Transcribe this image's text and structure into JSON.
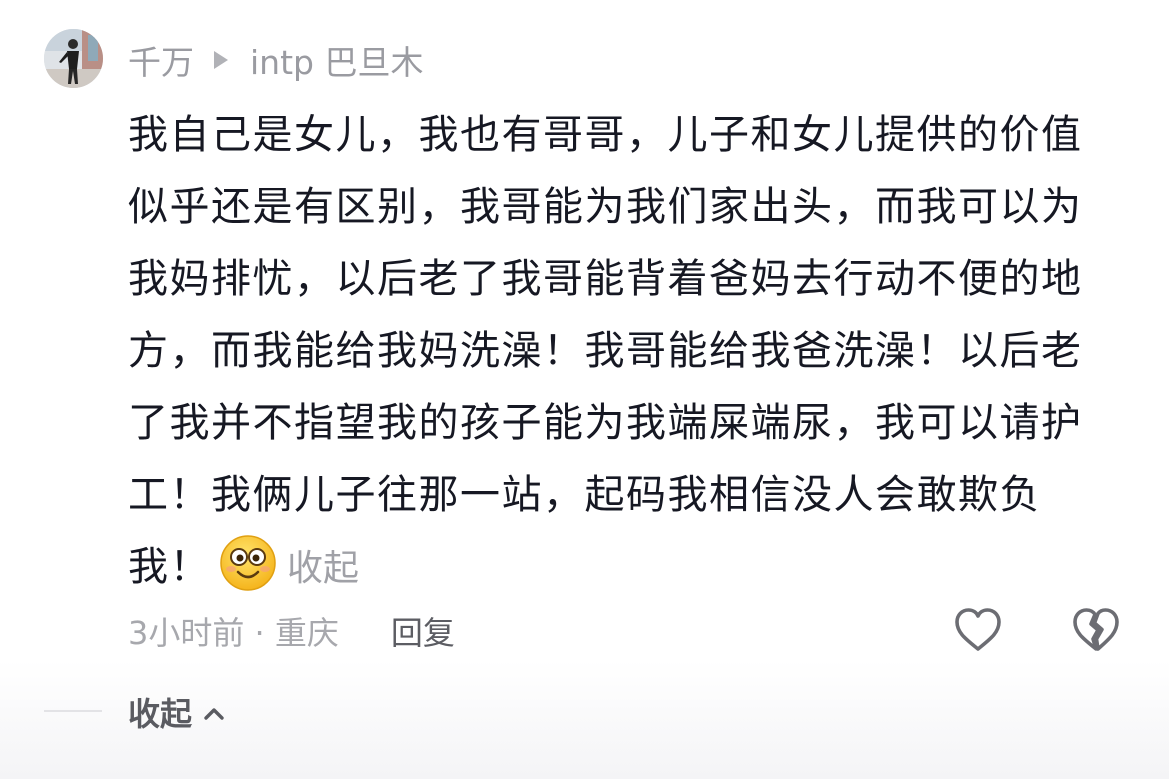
{
  "comment": {
    "author": "千万",
    "reply_to": "intp 巴旦木",
    "text": "我自己是女儿，我也有哥哥，儿子和女儿提供的价值似乎还是有区别，我哥能为我们家出头，而我可以为我妈排忧，以后老了我哥能背着爸妈去行动不便的地方，而我能给我妈洗澡！我哥能给我爸洗澡！以后老了我并不指望我的孩子能为我端屎端尿，我可以请护工！我俩儿子往那一站，起码我相信没人会敢欺负我！",
    "emoji": "smiling-face-emoji",
    "collapse_label": "收起",
    "time_location": "3小时前 · 重庆",
    "reply_label": "回复",
    "icons": {
      "like": "heart-outline-icon",
      "dislike": "broken-heart-icon"
    }
  },
  "thread": {
    "collapse_all_label": "收起"
  },
  "colors": {
    "text_primary": "#161823",
    "text_secondary": "#9a9ba1",
    "text_action": "#5c5d63",
    "background": "#ffffff"
  }
}
